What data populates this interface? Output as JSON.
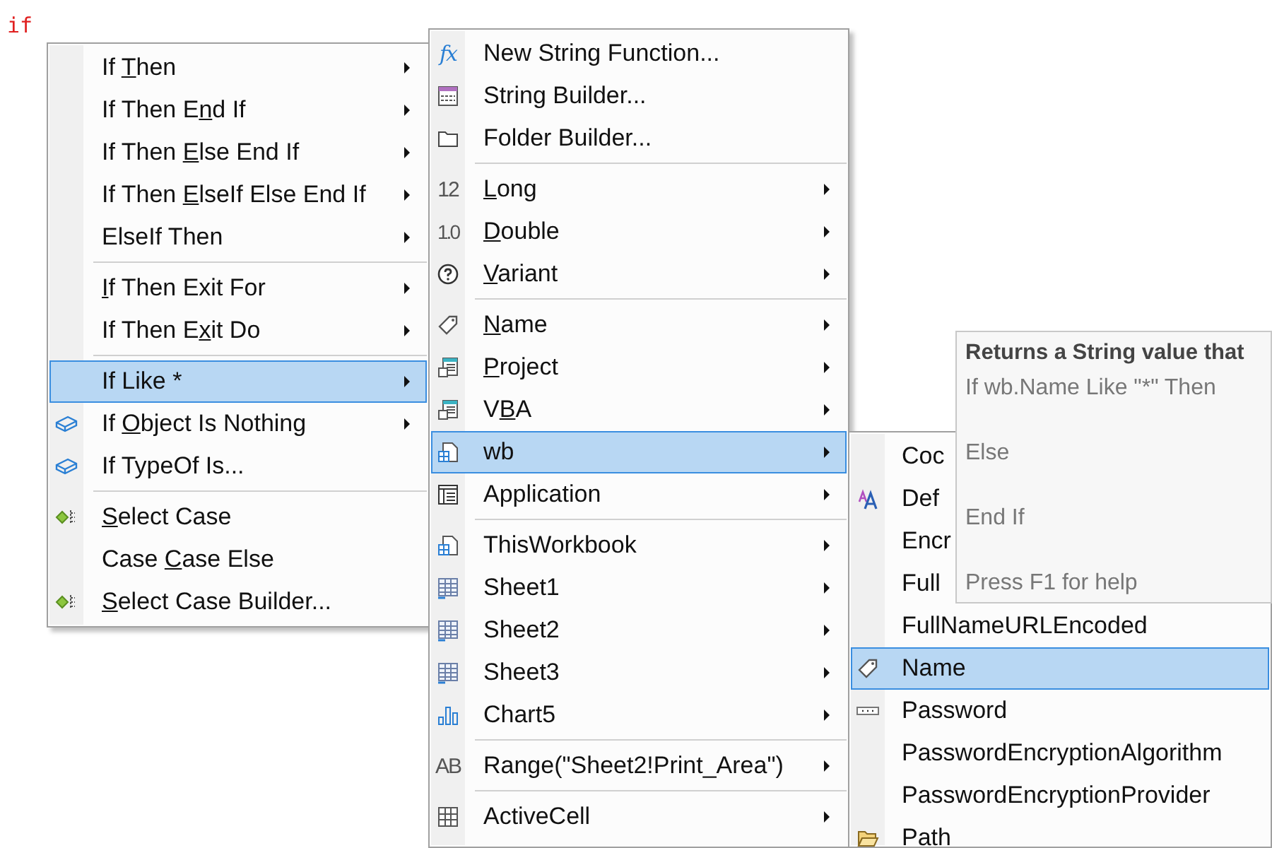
{
  "editor": {
    "code": "if"
  },
  "menus": [
    {
      "items": [
        {
          "kind": "plain",
          "pre": "If ",
          "key": "T",
          "post": "hen",
          "submenu": true,
          "selected": false
        },
        {
          "kind": "plain",
          "pre": "If Then E",
          "key": "n",
          "post": "d If",
          "submenu": true,
          "selected": false
        },
        {
          "kind": "plain",
          "pre": "If Then ",
          "key": "E",
          "post": "lse End If",
          "submenu": true,
          "selected": false
        },
        {
          "kind": "plain",
          "pre": "If Then ",
          "key": "E",
          "post": "lseIf Else End If",
          "submenu": true,
          "selected": false
        },
        {
          "kind": "plain",
          "pre": "ElseIf Then",
          "submenu": true,
          "selected": false
        },
        {
          "kind": "separator"
        },
        {
          "kind": "plain",
          "key": "I",
          "post": "f Then Exit For",
          "submenu": true,
          "selected": false
        },
        {
          "kind": "plain",
          "pre": "If Then E",
          "key": "x",
          "post": "it Do",
          "submenu": true,
          "selected": false
        },
        {
          "kind": "separator"
        },
        {
          "kind": "plain",
          "pre": "If Like *",
          "submenu": true,
          "selected": true
        },
        {
          "kind": "object",
          "pre": "If ",
          "key": "O",
          "post": "bject Is Nothing",
          "submenu": true,
          "selected": false
        },
        {
          "kind": "object",
          "pre": "If TypeOf Is...",
          "submenu": false,
          "selected": false
        },
        {
          "kind": "separator"
        },
        {
          "kind": "select",
          "key": "S",
          "post": "elect Case",
          "submenu": false,
          "selected": false
        },
        {
          "kind": "plain",
          "pre": "Case ",
          "key": "C",
          "post": "ase Else",
          "submenu": false,
          "selected": false
        },
        {
          "kind": "select",
          "key": "S",
          "post": "elect Case Builder...",
          "submenu": false,
          "selected": false
        }
      ]
    },
    {
      "items": [
        {
          "kind": "text-icon",
          "icon_text": "fx",
          "pre": "New String Function...",
          "submenu": false,
          "selected": false
        },
        {
          "kind": "form",
          "pre": "String Builder...",
          "submenu": false,
          "selected": false
        },
        {
          "kind": "folder",
          "pre": "Folder Builder...",
          "submenu": false,
          "selected": false
        },
        {
          "kind": "separator"
        },
        {
          "kind": "text-icon",
          "icon_text": "12",
          "key": "L",
          "post": "ong",
          "submenu": true,
          "selected": false
        },
        {
          "kind": "text-icon",
          "icon_text": "1.0",
          "key": "D",
          "post": "ouble",
          "submenu": true,
          "selected": false
        },
        {
          "kind": "question",
          "key": "V",
          "post": "ariant",
          "submenu": true,
          "selected": false
        },
        {
          "kind": "separator"
        },
        {
          "kind": "tag",
          "key": "N",
          "post": "ame",
          "submenu": true,
          "selected": false
        },
        {
          "kind": "module",
          "key": "P",
          "post": "roject",
          "submenu": true,
          "selected": false
        },
        {
          "kind": "module",
          "pre": "V",
          "key": "B",
          "post": "A",
          "submenu": true,
          "selected": false
        },
        {
          "kind": "workbook",
          "pre": "wb",
          "submenu": true,
          "selected": true
        },
        {
          "kind": "window",
          "pre": "Application",
          "submenu": true,
          "selected": false
        },
        {
          "kind": "separator"
        },
        {
          "kind": "workbook",
          "pre": "ThisWorkbook",
          "submenu": true,
          "selected": false
        },
        {
          "kind": "sheet",
          "pre": "Sheet1",
          "submenu": true,
          "selected": false
        },
        {
          "kind": "sheet",
          "pre": "Sheet2",
          "submenu": true,
          "selected": false
        },
        {
          "kind": "sheet",
          "pre": "Sheet3",
          "submenu": true,
          "selected": false
        },
        {
          "kind": "chart",
          "pre": "Chart5",
          "submenu": true,
          "selected": false
        },
        {
          "kind": "separator"
        },
        {
          "kind": "text-icon",
          "icon_text": "AB",
          "pre": "Range(\"Sheet2!Print_Area\")",
          "submenu": true,
          "selected": false
        },
        {
          "kind": "separator"
        },
        {
          "kind": "grid",
          "pre": "ActiveCell",
          "submenu": true,
          "selected": false
        }
      ]
    },
    {
      "items": [
        {
          "kind": "plain",
          "pre": "Coc",
          "selected": false
        },
        {
          "kind": "font",
          "pre": "Def",
          "selected": false
        },
        {
          "kind": "plain",
          "pre": "Encr",
          "selected": false
        },
        {
          "kind": "plain",
          "pre": "Full",
          "selected": false
        },
        {
          "kind": "plain",
          "pre": "FullNameURLEncoded",
          "selected": false
        },
        {
          "kind": "tag",
          "pre": "Name",
          "selected": true
        },
        {
          "kind": "password",
          "pre": "Password",
          "selected": false
        },
        {
          "kind": "plain",
          "pre": "PasswordEncryptionAlgorithm",
          "selected": false
        },
        {
          "kind": "plain",
          "pre": "PasswordEncryptionProvider",
          "selected": false
        },
        {
          "kind": "open-folder",
          "pre": "Path",
          "selected": false
        }
      ]
    }
  ],
  "tooltip": {
    "title": "Returns a String value that",
    "lines": [
      "If wb.Name Like \"*\" Then",
      "Else",
      "End If"
    ],
    "help": "Press F1 for help"
  }
}
